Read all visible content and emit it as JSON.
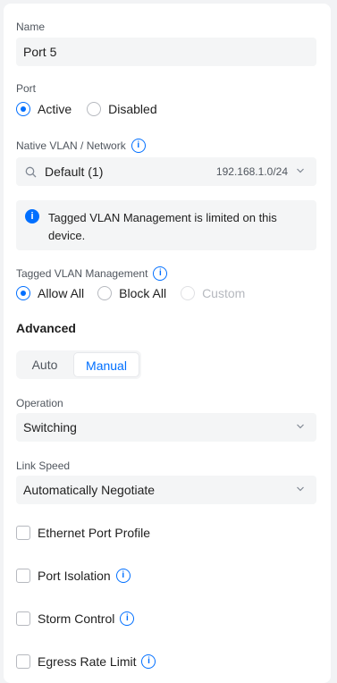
{
  "name": {
    "label": "Name",
    "value": "Port 5"
  },
  "port": {
    "label": "Port",
    "options": [
      {
        "label": "Active",
        "selected": true
      },
      {
        "label": "Disabled",
        "selected": false
      }
    ]
  },
  "native_vlan": {
    "label": "Native VLAN / Network",
    "value": "Default (1)",
    "subnet": "192.168.1.0/24"
  },
  "notice": {
    "text": "Tagged VLAN Management is limited on this device."
  },
  "tagged_vlan": {
    "label": "Tagged VLAN Management",
    "options": [
      {
        "label": "Allow All",
        "selected": true,
        "disabled": false
      },
      {
        "label": "Block All",
        "selected": false,
        "disabled": false
      },
      {
        "label": "Custom",
        "selected": false,
        "disabled": true
      }
    ]
  },
  "advanced": {
    "title": "Advanced",
    "tabs": [
      {
        "label": "Auto",
        "active": false
      },
      {
        "label": "Manual",
        "active": true
      }
    ]
  },
  "operation": {
    "label": "Operation",
    "value": "Switching"
  },
  "link_speed": {
    "label": "Link Speed",
    "value": "Automatically Negotiate"
  },
  "checkboxes": [
    {
      "label": "Ethernet Port Profile",
      "checked": false,
      "info": false
    },
    {
      "label": "Port Isolation",
      "checked": false,
      "info": true
    },
    {
      "label": "Storm Control",
      "checked": false,
      "info": true
    },
    {
      "label": "Egress Rate Limit",
      "checked": false,
      "info": true
    }
  ],
  "colors": {
    "accent": "#006fff",
    "field_bg": "#f4f5f6",
    "text": "#212121",
    "muted": "#50565e"
  }
}
